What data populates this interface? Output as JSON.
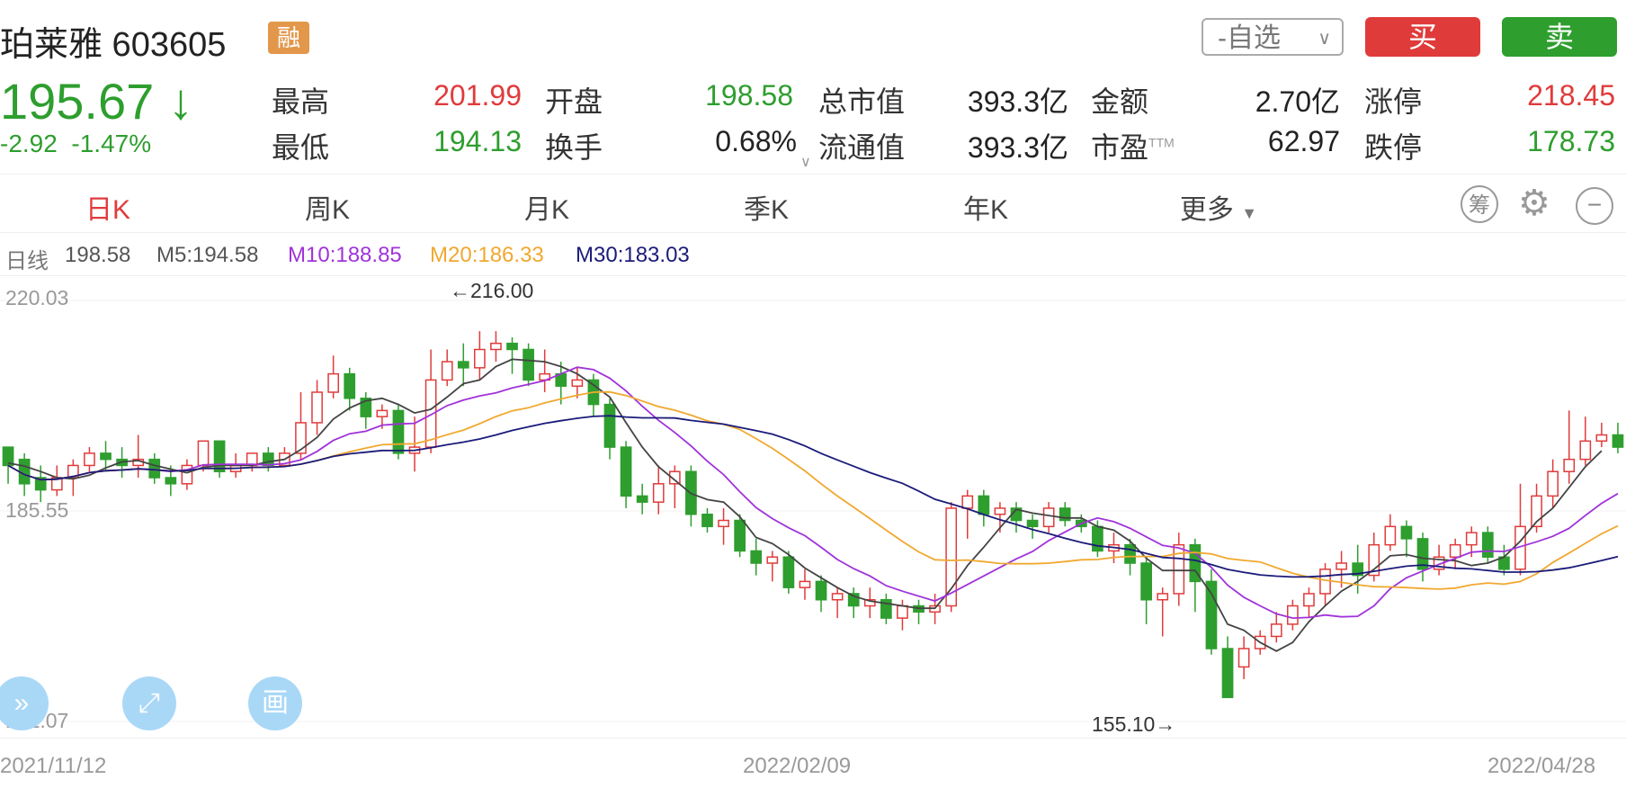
{
  "stock": {
    "name_code": "珀莱雅 603605",
    "margin_badge": "融",
    "price": "195.67",
    "trend_arrow": "↓",
    "change": "-2.92",
    "change_pct": "-1.47%"
  },
  "header": {
    "watch_label": "-自选",
    "buy_label": "买",
    "sell_label": "卖"
  },
  "quote": {
    "high_label": "最高",
    "high": "201.99",
    "low_label": "最低",
    "low": "194.13",
    "open_label": "开盘",
    "open": "198.58",
    "turnover_label": "换手",
    "turnover": "0.68%",
    "mktcap_label": "总市值",
    "mktcap": "393.3亿",
    "float_label": "流通值",
    "float_cap": "393.3亿",
    "amount_label": "金额",
    "amount": "2.70亿",
    "pe_label": "市盈",
    "pe_sup": "TTM",
    "pe": "62.97",
    "limitup_label": "涨停",
    "limitup": "218.45",
    "limitdown_label": "跌停",
    "limitdown": "178.73"
  },
  "tabs": [
    "日K",
    "周K",
    "月K",
    "季K",
    "年K",
    "更多"
  ],
  "tools": {
    "chip": "筹"
  },
  "ma_line": {
    "kind": "日线",
    "last": "198.58",
    "m5": "M5:194.58",
    "m10": "M10:188.85",
    "m20": "M20:186.33",
    "m30": "M30:183.03"
  },
  "colors": {
    "up": "#e03b3b",
    "down": "#2e9e2e",
    "m5": "#444444",
    "m10": "#a033d9",
    "m20": "#f0a830",
    "m30": "#1b1b7a"
  },
  "chart_data": {
    "type": "candlestick",
    "ylim": [
      151.07,
      220.03
    ],
    "y_ticks": [
      "220.03",
      "185.55",
      "151.07"
    ],
    "x_ticks": [
      "2021/11/12",
      "2022/02/09",
      "2022/04/28"
    ],
    "max_annotation": "←216.00",
    "min_annotation": "155.10→",
    "candles": [
      [
        196,
        193,
        195,
        190
      ],
      [
        194,
        190,
        195,
        188
      ],
      [
        191,
        189,
        193,
        187
      ],
      [
        189,
        191,
        193,
        188
      ],
      [
        191,
        193,
        194,
        188
      ],
      [
        193,
        195,
        196,
        192
      ],
      [
        195,
        194,
        197,
        192
      ],
      [
        194,
        193,
        196,
        191
      ],
      [
        193,
        194,
        198,
        191
      ],
      [
        194,
        191,
        195,
        190
      ],
      [
        191,
        190,
        193,
        188
      ],
      [
        190,
        193,
        194,
        189
      ],
      [
        193,
        197,
        197,
        192
      ],
      [
        197,
        192,
        197,
        191
      ],
      [
        192,
        193,
        195,
        191
      ],
      [
        193,
        195,
        195,
        192
      ],
      [
        195,
        193,
        196,
        192
      ],
      [
        193,
        195,
        196,
        193
      ],
      [
        195,
        200,
        205,
        194
      ],
      [
        200,
        205,
        207,
        198
      ],
      [
        205,
        208,
        211,
        204
      ],
      [
        208,
        204,
        209,
        202
      ],
      [
        204,
        201,
        205,
        199
      ],
      [
        201,
        202,
        203,
        199
      ],
      [
        202,
        195,
        203,
        194
      ],
      [
        195,
        196,
        201,
        192
      ],
      [
        196,
        207,
        212,
        195
      ],
      [
        207,
        210,
        212,
        206
      ],
      [
        210,
        209,
        213,
        206
      ],
      [
        209,
        212,
        215,
        207
      ],
      [
        212,
        213,
        215,
        210
      ],
      [
        213,
        212,
        214,
        208
      ],
      [
        212,
        207,
        213,
        206
      ],
      [
        207,
        208,
        212,
        205
      ],
      [
        208,
        206,
        210,
        203
      ],
      [
        206,
        207,
        209,
        204
      ],
      [
        207,
        203,
        208,
        201
      ],
      [
        203,
        196,
        204,
        194
      ],
      [
        196,
        188,
        197,
        186
      ],
      [
        188,
        187,
        190,
        185
      ],
      [
        187,
        190,
        193,
        185
      ],
      [
        190,
        192,
        193,
        186
      ],
      [
        192,
        185,
        193,
        183
      ],
      [
        185,
        183,
        186,
        182
      ],
      [
        183,
        184,
        186,
        180
      ],
      [
        184,
        179,
        185,
        178
      ],
      [
        179,
        177,
        181,
        175
      ],
      [
        177,
        178,
        179,
        174
      ],
      [
        178,
        173,
        179,
        172
      ],
      [
        173,
        174,
        176,
        171
      ],
      [
        174,
        171,
        175,
        169
      ],
      [
        171,
        172,
        173,
        168
      ],
      [
        172,
        170,
        173,
        168
      ],
      [
        170,
        171,
        173,
        168
      ],
      [
        171,
        168,
        172,
        167
      ],
      [
        168,
        170,
        171,
        166
      ],
      [
        170,
        169,
        171,
        167
      ],
      [
        169,
        170,
        172,
        167
      ],
      [
        170,
        186,
        187,
        169
      ],
      [
        186,
        188,
        189,
        181
      ],
      [
        188,
        185,
        189,
        183
      ],
      [
        185,
        186,
        187,
        182
      ],
      [
        186,
        184,
        187,
        182
      ],
      [
        184,
        183,
        185,
        181
      ],
      [
        183,
        186,
        187,
        182
      ],
      [
        186,
        184,
        187,
        183
      ],
      [
        184,
        183,
        185,
        182
      ],
      [
        183,
        179,
        184,
        178
      ],
      [
        179,
        180,
        182,
        177
      ],
      [
        180,
        177,
        181,
        175
      ],
      [
        177,
        171,
        178,
        167
      ],
      [
        171,
        172,
        173,
        165
      ],
      [
        172,
        180,
        182,
        170
      ],
      [
        180,
        174,
        181,
        169
      ],
      [
        174,
        163,
        176,
        162
      ],
      [
        163,
        155,
        165,
        155
      ],
      [
        160,
        163,
        165,
        158
      ],
      [
        163,
        165,
        166,
        162
      ],
      [
        165,
        167,
        169,
        164
      ],
      [
        167,
        170,
        171,
        166
      ],
      [
        170,
        172,
        173,
        168
      ],
      [
        172,
        176,
        177,
        170
      ],
      [
        176,
        177,
        179,
        173
      ],
      [
        177,
        175,
        180,
        172
      ],
      [
        175,
        180,
        182,
        174
      ],
      [
        180,
        183,
        185,
        179
      ],
      [
        183,
        181,
        184,
        178
      ],
      [
        181,
        176,
        182,
        174
      ],
      [
        176,
        178,
        180,
        175
      ],
      [
        178,
        180,
        181,
        176
      ],
      [
        180,
        182,
        183,
        178
      ],
      [
        182,
        178,
        183,
        177
      ],
      [
        178,
        176,
        180,
        175
      ],
      [
        176,
        183,
        190,
        175
      ],
      [
        183,
        188,
        190,
        182
      ],
      [
        188,
        192,
        194,
        186
      ],
      [
        192,
        194,
        202,
        190
      ],
      [
        194,
        197,
        201,
        193
      ],
      [
        197,
        198,
        200,
        196
      ],
      [
        198,
        196,
        200,
        195
      ]
    ],
    "ma5": [
      193.4,
      192.9,
      192.0,
      191.0,
      190.8,
      191.4,
      192.6,
      193.6,
      193.8,
      193.0,
      192.4,
      191.8,
      192.7,
      193.0,
      193.0,
      193.0,
      193.6,
      194.0,
      195.6,
      197.6,
      200.6,
      202.4,
      203.6,
      204.0,
      203.0,
      201.6,
      202.2,
      204.2,
      206.4,
      207.0,
      209.2,
      210.4,
      210.2,
      210.0,
      209.2,
      208.0,
      206.2,
      204.2,
      200.0,
      196.0,
      192.8,
      190.6,
      188.4,
      187.4,
      187.0,
      184.6,
      181.2,
      180.2,
      178.4,
      176.2,
      174.6,
      173.0,
      171.6,
      170.8,
      170.4,
      170.0,
      169.6,
      169.6,
      172.8,
      176.6,
      179.6,
      182.8,
      185.8,
      185.2,
      184.8,
      184.4,
      184.4,
      183.0,
      182.4,
      180.6,
      177.8,
      175.8,
      175.8,
      175.8,
      172.0,
      167.0,
      166.0,
      164.0,
      162.6,
      164.0,
      167.4,
      170.0,
      172.4,
      174.0,
      176.0,
      178.2,
      178.4,
      177.8,
      177.6,
      177.4,
      176.6,
      177.0,
      178.0,
      180.6,
      183.8,
      186.0,
      189.4,
      192.8,
      195.4
    ]
  }
}
